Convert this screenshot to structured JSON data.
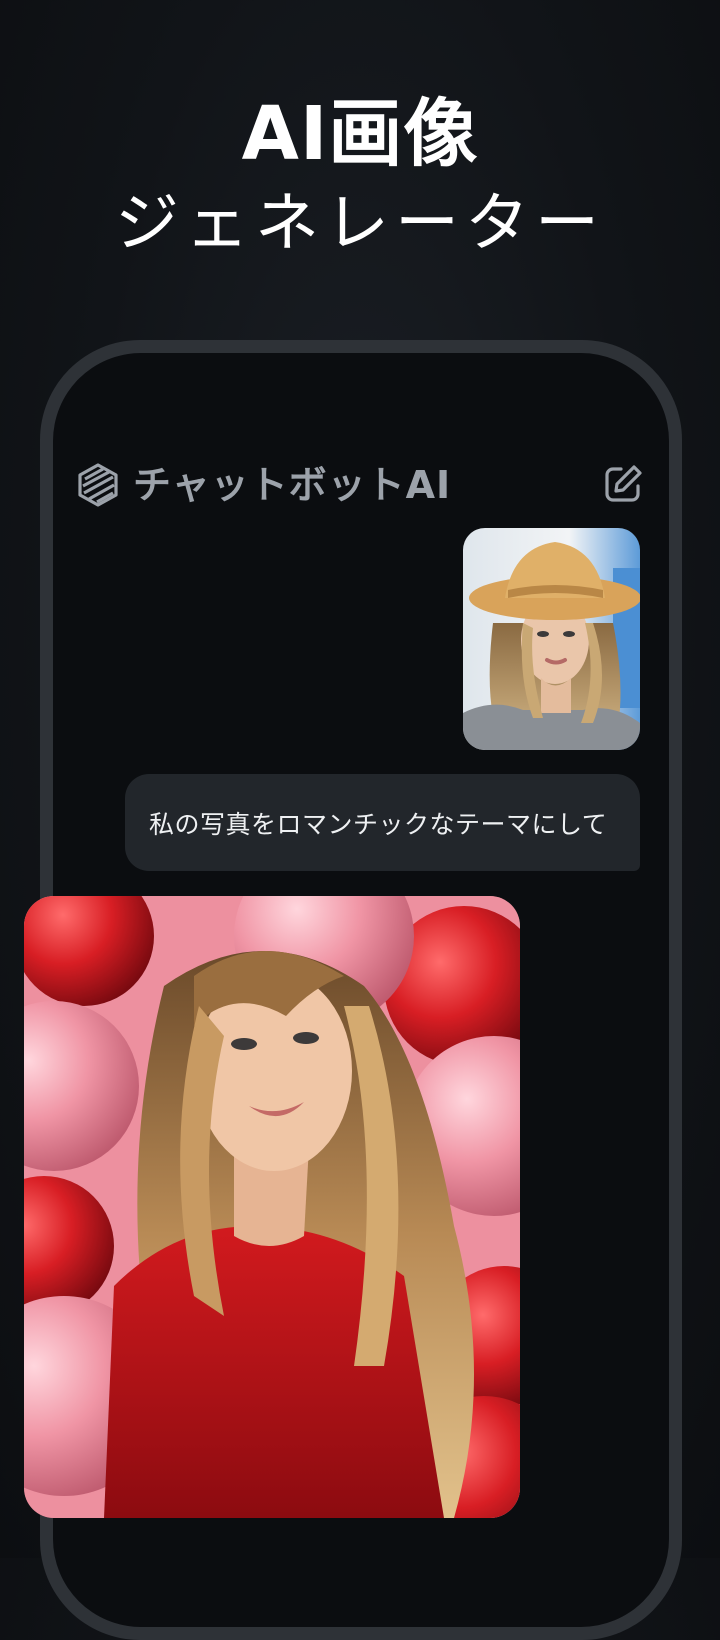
{
  "headline": {
    "line1": "AI画像",
    "line2": "ジェネレーター"
  },
  "app": {
    "title": "チャットボットAI",
    "logo_icon": "logo-icon",
    "edit_icon": "edit-icon"
  },
  "chat": {
    "user_message": "私の写真をロマンチックなテーマにして",
    "sent_image": "user-photo-hat",
    "result_image": "romantic-photo-balloons"
  },
  "colors": {
    "background": "#111418",
    "phone_frame": "#2e3237",
    "bubble": "#22262b",
    "title_gray": "#9ca2aa"
  }
}
